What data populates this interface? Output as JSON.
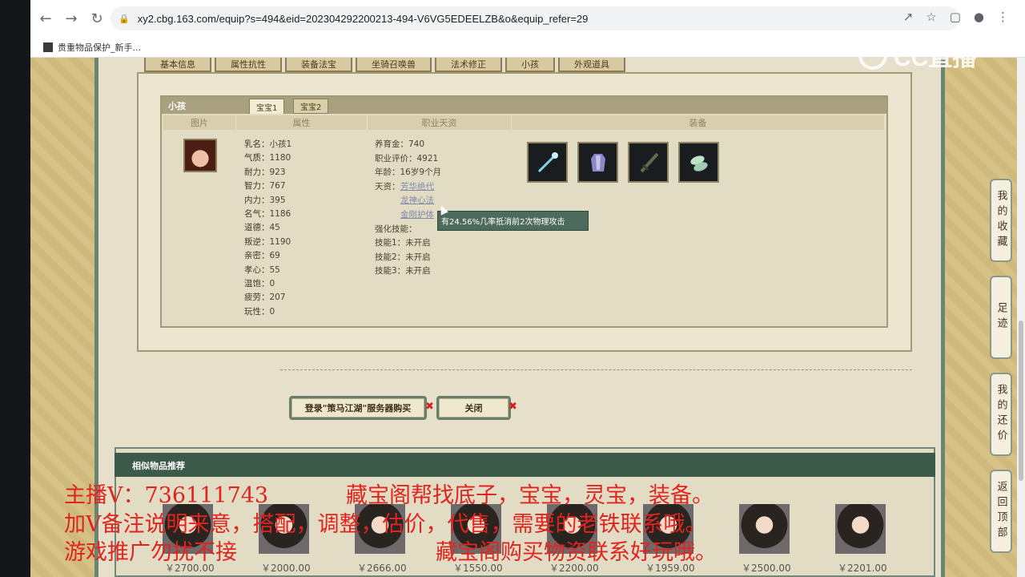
{
  "browser": {
    "url": "xy2.cbg.163.com/equip?s=494&eid=202304292200213-494-V6VG5EDEELZB&o&equip_refer=29",
    "bookmark": "贵重物品保护_新手..."
  },
  "top_tabs": [
    "基本信息",
    "属性抗性",
    "装备法宝",
    "坐骑召唤兽",
    "法术修正",
    "小孩",
    "外观道具"
  ],
  "kid_panel": {
    "title": "小孩",
    "tabs": [
      "宝宝1",
      "宝宝2"
    ],
    "columns": [
      "图片",
      "属性",
      "职业天资",
      "装备"
    ],
    "attributes": [
      {
        "label": "乳名：",
        "value": "小孩1"
      },
      {
        "label": "气质：",
        "value": "1180"
      },
      {
        "label": "耐力：",
        "value": "923"
      },
      {
        "label": "智力：",
        "value": "767"
      },
      {
        "label": "内力：",
        "value": "395"
      },
      {
        "label": "名气：",
        "value": "1186"
      },
      {
        "label": "道德：",
        "value": "45"
      },
      {
        "label": "叛逆：",
        "value": "1190"
      },
      {
        "label": "亲密：",
        "value": "69"
      },
      {
        "label": "孝心：",
        "value": "55"
      },
      {
        "label": "温饱：",
        "value": "0"
      },
      {
        "label": "疲劳：",
        "value": "207"
      },
      {
        "label": "玩性：",
        "value": "0"
      }
    ],
    "career": [
      {
        "label": "养育金：",
        "value": "740"
      },
      {
        "label": "职业评价：",
        "value": "4921"
      },
      {
        "label": "年龄：",
        "value": "16岁9个月"
      }
    ],
    "talent_label": "天资：",
    "talents": [
      "芳华绝代",
      "龙神心法",
      "金刚护体"
    ],
    "skills": [
      {
        "label": "强化技能：",
        "value": ""
      },
      {
        "label": "技能1：",
        "value": "未开启"
      },
      {
        "label": "技能2：",
        "value": "未开启"
      },
      {
        "label": "技能3：",
        "value": "未开启"
      }
    ],
    "tooltip": "有24.56%几率抵消前2次物理攻击"
  },
  "buttons": {
    "login": "登录\"策马江湖\"服务器购买",
    "close": "关闭"
  },
  "similar": {
    "title": "相似物品推荐",
    "prices": [
      "￥2700.00",
      "￥2000.00",
      "￥2666.00",
      "￥1550.00",
      "￥2200.00",
      "￥1959.00",
      "￥2500.00",
      "￥2201.00"
    ]
  },
  "overlay": {
    "line1a": "主播V：736111743",
    "line1b": "藏宝阁帮找底子，宝宝，灵宝，装备。",
    "line2": "加V备注说明来意，搭配，调整，估价，代售，需要的老铁联系哦。",
    "line3a": "游戏推广勿扰不接",
    "line3b": "藏宝阁购买物资联系好玩哦。"
  },
  "side_buttons": [
    "我的收藏",
    "足迹",
    "我的还价",
    "返回顶部"
  ],
  "watermark": "CC直播"
}
